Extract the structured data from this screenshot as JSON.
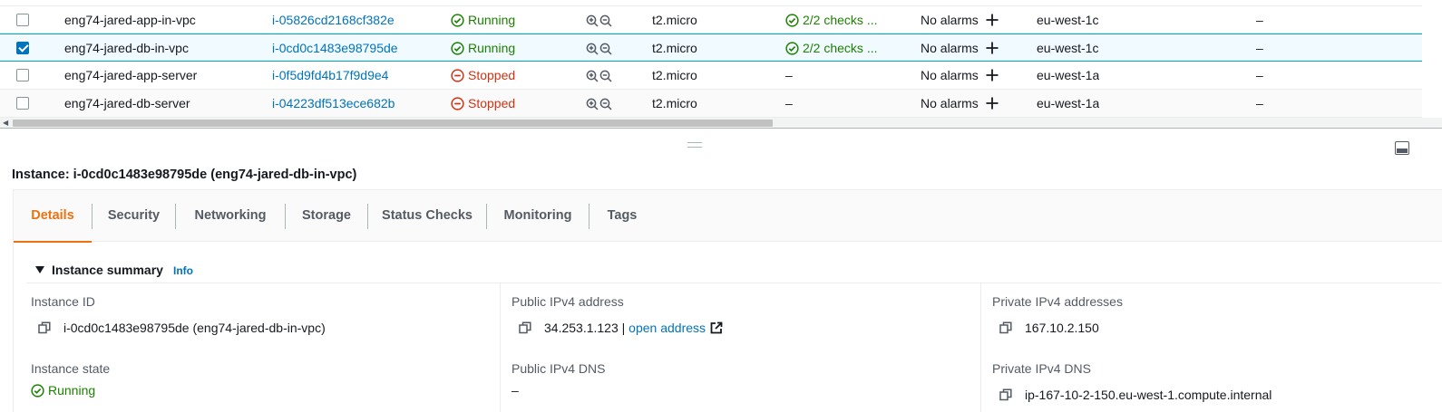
{
  "table": {
    "rows": [
      {
        "checked": false,
        "name": "eng74-jared-app-in-vpc",
        "id": "i-05826cd2168cf382e",
        "state": "Running",
        "state_kind": "running",
        "type": "t2.micro",
        "checks": "2/2 checks ...",
        "alarms": "No alarms",
        "az": "eu-west-1c",
        "extra": "–"
      },
      {
        "checked": true,
        "name": "eng74-jared-db-in-vpc",
        "id": "i-0cd0c1483e98795de",
        "state": "Running",
        "state_kind": "running",
        "type": "t2.micro",
        "checks": "2/2 checks ...",
        "alarms": "No alarms",
        "az": "eu-west-1c",
        "extra": "–"
      },
      {
        "checked": false,
        "name": "eng74-jared-app-server",
        "id": "i-0f5d9fd4b17f9d9e4",
        "state": "Stopped",
        "state_kind": "stopped",
        "type": "t2.micro",
        "checks": "–",
        "alarms": "No alarms",
        "az": "eu-west-1a",
        "extra": "–"
      },
      {
        "checked": false,
        "name": "eng74-jared-db-server",
        "id": "i-04223df513ece682b",
        "state": "Stopped",
        "state_kind": "stopped",
        "type": "t2.micro",
        "checks": "–",
        "alarms": "No alarms",
        "az": "eu-west-1a",
        "extra": "–"
      }
    ]
  },
  "detail": {
    "title": "Instance: i-0cd0c1483e98795de (eng74-jared-db-in-vpc)",
    "tabs": [
      {
        "label": "Details"
      },
      {
        "label": "Security"
      },
      {
        "label": "Networking"
      },
      {
        "label": "Storage"
      },
      {
        "label": "Status Checks"
      },
      {
        "label": "Monitoring"
      },
      {
        "label": "Tags"
      }
    ],
    "active_tab": "Details",
    "summary": {
      "heading": "Instance summary",
      "info": "Info",
      "instance_id_label": "Instance ID",
      "instance_id_value": "i-0cd0c1483e98795de (eng74-jared-db-in-vpc)",
      "public_ipv4_label": "Public IPv4 address",
      "public_ipv4_value": "34.253.1.123 |",
      "open_address": "open address",
      "private_ipv4_label": "Private IPv4 addresses",
      "private_ipv4_value": "167.10.2.150",
      "instance_state_label": "Instance state",
      "instance_state_value": "Running",
      "public_dns_label": "Public IPv4 DNS",
      "public_dns_value": "–",
      "private_dns_label": "Private IPv4 DNS",
      "private_dns_value": "ip-167-10-2-150.eu-west-1.compute.internal"
    }
  },
  "colors": {
    "running": "#1d8102",
    "stopped": "#d13212",
    "link": "#0073bb",
    "active_tab": "#ec7211"
  },
  "icons": [
    "checkbox",
    "status-ok-icon",
    "status-stopped-icon",
    "zoom-in-icon",
    "zoom-out-icon",
    "add-alarm-icon",
    "copy-icon",
    "external-link-icon",
    "collapse-caret-icon",
    "panel-toggle-icon"
  ]
}
